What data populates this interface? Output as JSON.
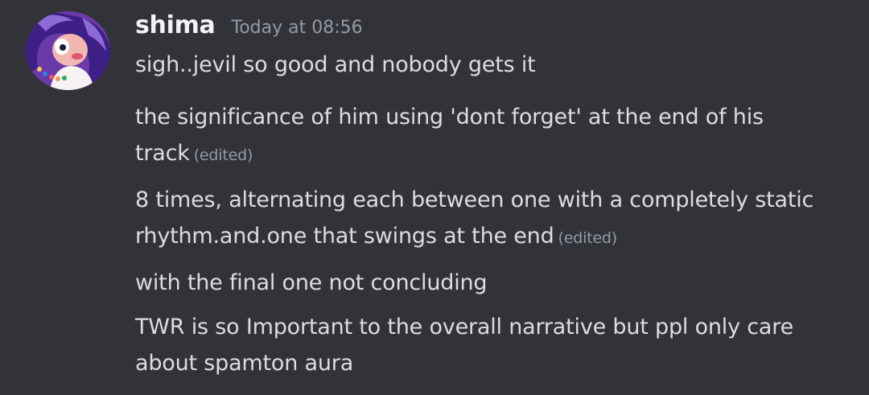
{
  "message_group": {
    "username": "shima",
    "timestamp": "Today at 08:56",
    "messages": [
      {
        "text": "sigh..jevil so good and nobody gets it",
        "edited": ""
      },
      {
        "text": "the significance of him using 'dont forget' at the end of his track",
        "edited": "(edited)"
      },
      {
        "text": "8 times, alternating each between one with a completely static rhythm.and.one that swings at the end",
        "edited": "(edited)"
      },
      {
        "text": "with the final one not concluding",
        "edited": ""
      },
      {
        "text": "TWR is so Important to the overall narrative but ppl only care about spamton aura",
        "edited": ""
      }
    ]
  },
  "colors": {
    "background": "#313338",
    "username": "#f2f3f5",
    "timestamp": "#949ba4",
    "message_text": "#dbdee1"
  },
  "icons": {
    "avatar": "user-avatar-purple-haired-character"
  }
}
